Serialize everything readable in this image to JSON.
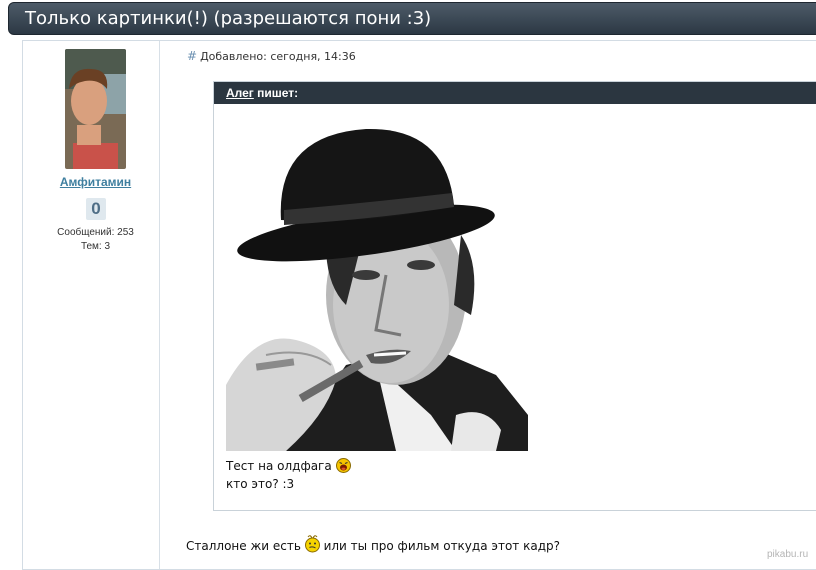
{
  "topic": {
    "title": "Только картинки(!) (разрешаются пони :3)"
  },
  "post": {
    "author": {
      "name": "Амфитамин",
      "reputation": "0",
      "posts_label": "Сообщений: 253",
      "topics_label": "Тем: 3"
    },
    "meta": {
      "anchor": "#",
      "added": "Добавлено: сегодня, 14:36"
    },
    "quote": {
      "author": "Алег",
      "writes": "пишет:",
      "line1": "Тест на олдфага",
      "line2": "кто это? :3"
    },
    "reply": {
      "part1": "Сталлоне жи есть",
      "part2": "или ты про фильм откуда этот кадр?"
    }
  },
  "watermark": "pikabu.ru",
  "icons": {
    "smiley_laugh": "laughing-smiley-icon",
    "smiley_confused": "confused-smiley-icon"
  },
  "colors": {
    "header_bg": "#3a4754",
    "author_link": "#3f7f9f",
    "quote_header_bg": "#2b3640"
  }
}
